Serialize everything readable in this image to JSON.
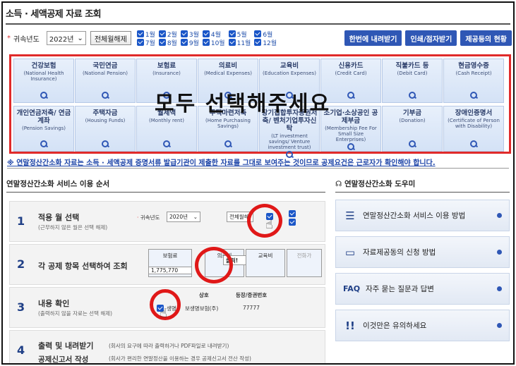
{
  "page": {
    "title": "소득 · 세액공제 자료 조회"
  },
  "filter": {
    "required_mark": "*",
    "year_label": "귀속년도",
    "year_value": "2022년",
    "toggle_all_label": "전체월해제",
    "months": [
      "1월",
      "2월",
      "3월",
      "4월",
      "5월",
      "6월",
      "7월",
      "8월",
      "9월",
      "10월",
      "11월",
      "12월"
    ],
    "actions": [
      "한번에 내려받기",
      "인쇄/점자받기",
      "제공등의 현황"
    ]
  },
  "categories": [
    {
      "ko": "건강보험",
      "en": "(National Health Insurance)"
    },
    {
      "ko": "국민연금",
      "en": "(National Pension)"
    },
    {
      "ko": "보험료",
      "en": "(Insurance)"
    },
    {
      "ko": "의료비",
      "en": "(Medical Expenses)"
    },
    {
      "ko": "교육비",
      "en": "(Education Expenses)"
    },
    {
      "ko": "신용카드",
      "en": "(Credit Card)"
    },
    {
      "ko": "직불카드 등",
      "en": "(Debit Card)"
    },
    {
      "ko": "현금영수증",
      "en": "(Cash Receipt)"
    },
    {
      "ko": "개인연금저축/ 연금계좌",
      "en": "(Pension Savings)"
    },
    {
      "ko": "주택자금",
      "en": "(Housing Funds)"
    },
    {
      "ko": "월세액",
      "en": "(Monthly rent)"
    },
    {
      "ko": "주택마련저축",
      "en": "(Home Purchasing Savings)"
    },
    {
      "ko": "장기집합투자증권저축/ 벤처기업투자신탁",
      "en": "(LT investment savings/ Venture investment trust)"
    },
    {
      "ko": "소기업·소상공인 공제부금",
      "en": "(Membership Fee For Small Size Enterprises)"
    },
    {
      "ko": "기부금",
      "en": "(Donation)"
    },
    {
      "ko": "장애인증명서",
      "en": "(Certificate of Person with Disability)"
    }
  ],
  "overlay_text": "모두 선택해주세요",
  "notice": "※ 연말정산간소화 자료는 소득 · 세액공제 증명서류 발급기관이 제출한 자료를 그대로 보여주는 것이므로 공제요건은 근로자가 확인해야 합니다.",
  "steps_section": {
    "title": "연말정산간소화 서비스 이용 순서",
    "steps": [
      {
        "num": "1",
        "title": "적용 월 선택",
        "sub": "(근무하지 않은 월은 선택 해제)"
      },
      {
        "num": "2",
        "title": "각 공제 항목 선택하여 조회",
        "sub": ""
      },
      {
        "num": "3",
        "title": "내용 확인",
        "sub": "(출력하지 않을 자료는 선택 해제)"
      },
      {
        "num": "4",
        "title": "출력 및 내려받기",
        "title2": "공제신고서 작성",
        "desc1": "(회사의 요구에 따라 출력하거나 PDF파일로 내려받기)",
        "desc2": "(회사가 편리한 연말정산을 이용하는 경우 공제신고서 전산 작성)"
      }
    ],
    "step1_mock": {
      "label": "귀속년도",
      "year": "2020년",
      "button": "전체월해"
    },
    "step2_mock": {
      "items": [
        "보험료",
        "의료비",
        "교육비",
        "전화가"
      ],
      "amount": "1,775,770",
      "popup": "클릭!"
    },
    "step3_mock": {
      "col1": "상호",
      "col2": "등장/증권번호",
      "row_text": "생명",
      "row_company": "보생명보험(주)",
      "row_number": "77777"
    }
  },
  "helper_section": {
    "title": "연말정산간소화 도우미",
    "items": [
      {
        "icon": "list-icon",
        "label": "연말정산간소화 서비스 이용 방법"
      },
      {
        "icon": "document-icon",
        "label": "자료제공동의 신청 방법"
      },
      {
        "icon": "faq-icon",
        "label": "자주 묻는 질문과 답변"
      },
      {
        "icon": "exclamation-icon",
        "label": "이것만은 유의하세요"
      }
    ],
    "faq_prefix": "FAQ"
  },
  "colors": {
    "accent_blue": "#2f57b5",
    "highlight_red": "#e02a2a"
  }
}
